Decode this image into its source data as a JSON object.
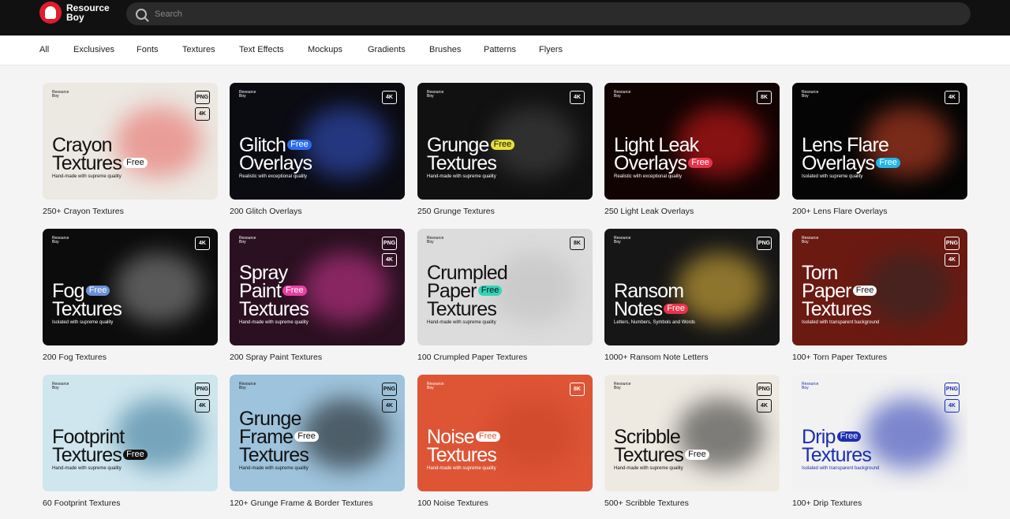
{
  "brand": {
    "name": "Resource Boy"
  },
  "search": {
    "placeholder": "Search"
  },
  "categories": [
    "All",
    "Exclusives",
    "Fonts",
    "Textures",
    "Text Effects",
    "Mockups",
    "Gradients",
    "Brushes",
    "Patterns",
    "Flyers"
  ],
  "thumb_brand": "Resource Boy",
  "cards": [
    {
      "label": "250+ Crayon Textures",
      "lines": [
        "Crayon",
        "Textures"
      ],
      "free_line": 1,
      "badges": [
        "PNG",
        "4K"
      ],
      "subtitle": "Hand-made with supreme quality",
      "bg": "#ece8e2",
      "fg": "#111",
      "free_bg": "#ffffff",
      "free_fg": "#111",
      "accent": "#e8615c"
    },
    {
      "label": "200 Glitch Overlays",
      "lines": [
        "Glitch",
        "Overlays"
      ],
      "free_line": 0,
      "badges": [
        "4K"
      ],
      "subtitle": "Realistic with exceptional quality",
      "bg": "#0b0b12",
      "fg": "#ffffff",
      "free_bg": "#2a6cf0",
      "free_fg": "#ffffff",
      "accent": "#3a5bd9"
    },
    {
      "label": "250 Grunge Textures",
      "lines": [
        "Grunge",
        "Textures"
      ],
      "free_line": 0,
      "badges": [
        "4K"
      ],
      "subtitle": "Hand-made with supreme quality",
      "bg": "#111111",
      "fg": "#ffffff",
      "free_bg": "#e6e03a",
      "free_fg": "#111",
      "accent": "#4a4a4a"
    },
    {
      "label": "250 Light Leak Overlays",
      "lines": [
        "Light Leak",
        "Overlays"
      ],
      "free_line": 1,
      "badges": [
        "8K"
      ],
      "subtitle": "Realistic with exceptional quality",
      "bg": "#120303",
      "fg": "#ffffff",
      "free_bg": "#e8324a",
      "free_fg": "#ffffff",
      "accent": "#e81f1f"
    },
    {
      "label": "200+ Lens Flare Overlays",
      "lines": [
        "Lens Flare",
        "Overlays"
      ],
      "free_line": 1,
      "badges": [
        "4K"
      ],
      "subtitle": "Isolated with supreme quality",
      "bg": "#050505",
      "fg": "#ffffff",
      "free_bg": "#1fb6e8",
      "free_fg": "#ffffff",
      "accent": "#d94a2a"
    },
    {
      "label": "200 Fog Textures",
      "lines": [
        "Fog",
        "Textures"
      ],
      "free_line": 0,
      "badges": [
        "4K"
      ],
      "subtitle": "Isolated with supreme quality",
      "bg": "#0c0c0c",
      "fg": "#ffffff",
      "free_bg": "#6b8fd6",
      "free_fg": "#ffffff",
      "accent": "#9a9a9a"
    },
    {
      "label": "200 Spray Paint Textures",
      "lines": [
        "Spray",
        "Paint",
        "Textures"
      ],
      "free_line": 1,
      "badges": [
        "PNG",
        "4K"
      ],
      "subtitle": "Hand-made with supreme quality",
      "bg": "#2a1020",
      "fg": "#ffffff",
      "free_bg": "#e83fa0",
      "free_fg": "#ffffff",
      "accent": "#d63a9a"
    },
    {
      "label": "100 Crumpled Paper Textures",
      "lines": [
        "Crumpled",
        "Paper",
        "Textures"
      ],
      "free_line": 1,
      "badges": [
        "8K"
      ],
      "subtitle": "Hand-made with supreme quality",
      "bg": "#dcdcdc",
      "fg": "#111",
      "free_bg": "#2fd6b6",
      "free_fg": "#111",
      "accent": "#bdbdbd"
    },
    {
      "label": "1000+ Ransom Note Letters",
      "lines": [
        "Ransom",
        "Notes"
      ],
      "free_line": 1,
      "badges": [
        "PNG"
      ],
      "subtitle": "Letters, Numbers, Symbols and Words",
      "bg": "#161616",
      "fg": "#ffffff",
      "free_bg": "#e8324a",
      "free_fg": "#ffffff",
      "accent": "#f2c341"
    },
    {
      "label": "100+ Torn Paper Textures",
      "lines": [
        "Torn",
        "Paper",
        "Textures"
      ],
      "free_line": 1,
      "badges": [
        "PNG",
        "4K"
      ],
      "subtitle": "Isolated with transparent background",
      "bg": "#6b1a12",
      "fg": "#ffffff",
      "free_bg": "#ffffff",
      "free_fg": "#111",
      "accent": "#2a2a2a"
    },
    {
      "label": "60 Footprint Textures",
      "lines": [
        "Footprint",
        "Textures"
      ],
      "free_line": 1,
      "badges": [
        "PNG",
        "4K"
      ],
      "subtitle": "Hand-made with supreme quality",
      "bg": "#cfe6ee",
      "fg": "#111",
      "free_bg": "#111",
      "free_fg": "#ffffff",
      "accent": "#2d6f93"
    },
    {
      "label": "120+ Grunge Frame & Border Textures",
      "lines": [
        "Grunge",
        "Frame",
        "Textures"
      ],
      "free_line": 1,
      "badges": [
        "PNG",
        "4K"
      ],
      "subtitle": "Hand-made with supreme quality",
      "bg": "#9ec3dc",
      "fg": "#111",
      "free_bg": "#ffffff",
      "free_fg": "#111",
      "accent": "#0c0c0c"
    },
    {
      "label": "100 Noise Textures",
      "lines": [
        "Noise",
        "Textures"
      ],
      "free_line": 0,
      "badges": [
        "8K"
      ],
      "subtitle": "Hand-made with supreme quality",
      "bg": "#de5536",
      "fg": "#ffffff",
      "free_bg": "#ffffff",
      "free_fg": "#de5536",
      "accent": "#c84526"
    },
    {
      "label": "500+ Scribble Textures",
      "lines": [
        "Scribble",
        "Textures"
      ],
      "free_line": 1,
      "badges": [
        "PNG",
        "4K"
      ],
      "subtitle": "Hand-made with supreme quality",
      "bg": "#eeeae2",
      "fg": "#111",
      "free_bg": "#ffffff",
      "free_fg": "#111",
      "accent": "#222"
    },
    {
      "label": "100+ Drip Textures",
      "lines": [
        "Drip",
        "Textures"
      ],
      "free_line": 0,
      "badges": [
        "PNG",
        "4K"
      ],
      "subtitle": "Isolated with transparent background",
      "bg": "#f2f2f2",
      "fg": "#1b2fb0",
      "free_bg": "#1b2fb0",
      "free_fg": "#ffffff",
      "accent": "#1b2fb0"
    }
  ],
  "free_text": "Free"
}
